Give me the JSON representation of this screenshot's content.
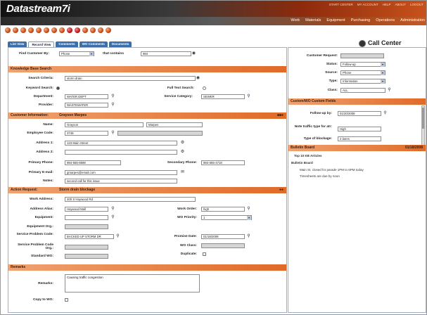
{
  "app": {
    "logo": "Datastream7i"
  },
  "top_links": [
    "START CENTER",
    "MY ACCOUNT",
    "HELP",
    "ABOUT",
    "LOGOUT"
  ],
  "main_nav": [
    "Work",
    "Materials",
    "Equipment",
    "Purchasing",
    "Operations",
    "Administration"
  ],
  "tabs": [
    "List View",
    "Record View",
    "Comments",
    "WO Comments",
    "Documents"
  ],
  "page_title": "Call Center",
  "find": {
    "label": "Find Customer By:",
    "select": "Phone",
    "contains_label": "that contains",
    "contains_value": "984"
  },
  "kb": {
    "header": "Knowledge Base Search",
    "search_criteria_label": "Search Criteria:",
    "search_criteria_value": "storm drain",
    "keyword_label": "Keyword Search:",
    "fulltext_label": "Full Text Search:",
    "department_label": "Department:",
    "department_value": "WATER DEPT",
    "service_category_label": "Service Category:",
    "service_category_value": "SEWER",
    "provider_label": "Provider:",
    "provider_value": "WASTEWATER"
  },
  "customer": {
    "header": "Customer Information:",
    "header_name": "Grayson Marpes",
    "name_label": "Name:",
    "first": "Grayson",
    "last": "Marpes",
    "emp_label": "Employee Code:",
    "emp_value": "3749",
    "addr1_label": "Address 1:",
    "addr1_value": "123 Main Street",
    "addr2_label": "Address 2:",
    "phone_label": "Primary Phone:",
    "phone_value": "984-555-8598",
    "sphone_label": "Secondary Phone:",
    "sphone_value": "984-555-4718",
    "email_label": "Primary E-mail:",
    "email_value": "gmarpes@email.com",
    "notes_label": "Notes:",
    "notes_value": "second call for this issue"
  },
  "action": {
    "header": "Action Request:",
    "header_value": "Storm drain blockage",
    "work_addr_label": "Work Address:",
    "work_addr_value": "200 S Haywood Rd",
    "alias_label": "Address Alias:",
    "alias_value": "Haywood Mall",
    "work_order_label": "Work Order:",
    "work_order_value": "high",
    "equip_label": "Equipment:",
    "wo_priority_label": "WO Priority:",
    "wo_priority_value": "1",
    "equip_org_label": "Equipment Org.:",
    "sp_code_label": "Service Problem Code:",
    "sp_code_value": "BACKED UP STORM DR",
    "promise_label": "Promise Date:",
    "promise_value": "01/18/2008",
    "sp_org_label": "Service Problem Code Org.:",
    "wo_class_label": "WO Class:",
    "std_wo_label": "Standard WO:",
    "duplicate_label": "Duplicate:"
  },
  "remarks": {
    "header": "Remarks",
    "label": "Remarks:",
    "value": "Causing traffic congestion",
    "copy_label": "Copy to WO:"
  },
  "right": {
    "cust_req_label": "Customer Request:",
    "status_label": "Status:",
    "status_value": "Follow-up",
    "source_label": "Source:",
    "source_value": "Phone",
    "type_label": "Type:",
    "type_value": "Information",
    "class_label": "Class:",
    "class_value": "ALL",
    "custom_header": "Custom/WO Custom Fields",
    "followup_label": "Follow-up by:",
    "followup_value": "01/20/2008",
    "traffic_label": "Note traffic type for atr:",
    "traffic_value": "High",
    "blockage_label": "Type of blockage:",
    "blockage_value": "2 lanes"
  },
  "bulletin": {
    "header": "Bulletin Board",
    "date": "01/18/2008",
    "top10": "Top 10 KB Articles",
    "bb": "Bulletin Board",
    "items": [
      "Main St. closed for parade 1PM to 6PM today",
      "Timesheets are due by noon"
    ]
  }
}
